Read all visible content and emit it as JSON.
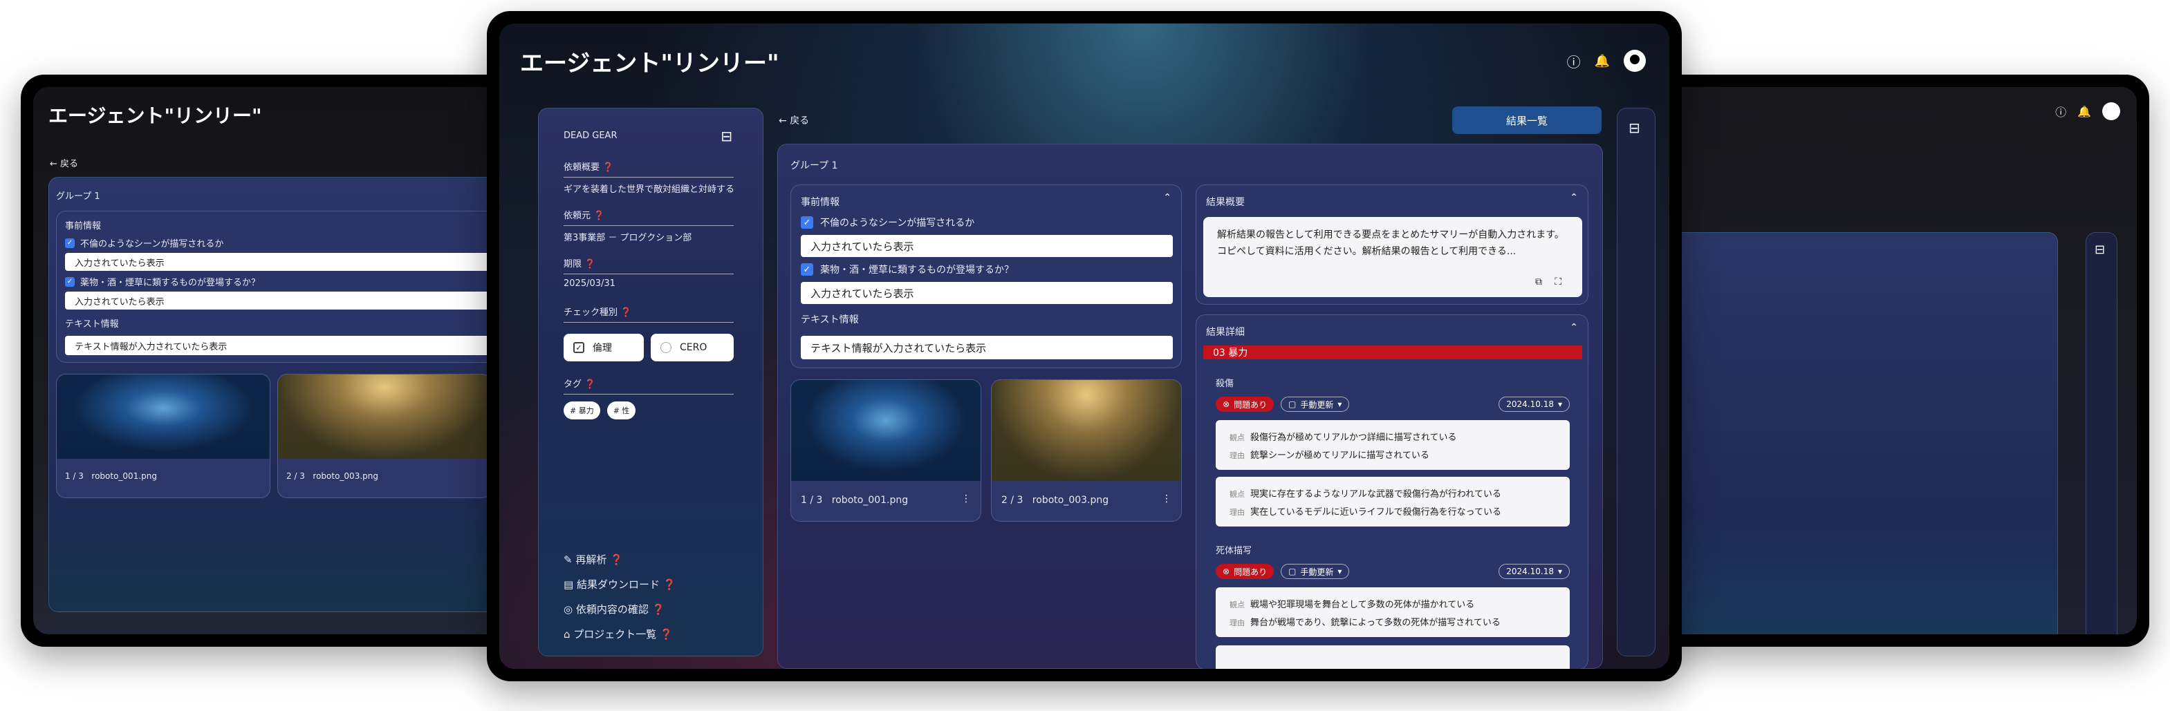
{
  "app": {
    "title": "エージェント\"リンリー\""
  },
  "nav": {
    "back_label": "戻る",
    "results_list_button": "結果一覧"
  },
  "sidebar": {
    "project": "DEAD GEAR",
    "fields": [
      {
        "label": "依頼概要",
        "value": "ギアを装着した世界で敵対組織と対峙する…"
      },
      {
        "label": "依頼元",
        "value": "第3事業部 － プログクション部"
      },
      {
        "label": "期限",
        "value": "2025/03/31"
      }
    ],
    "check_type_label": "チェック種別",
    "check_options": [
      {
        "label": "倫理",
        "checked": true
      },
      {
        "label": "CERO",
        "checked": false
      }
    ],
    "tags_label": "タグ",
    "tags": [
      "# 暴力",
      "# 性"
    ],
    "actions": [
      "再解析",
      "結果ダウンロード",
      "依頼内容の確認",
      "プロジェクト一覧"
    ]
  },
  "group": {
    "label": "グループ 1"
  },
  "pre_info": {
    "title": "事前情報",
    "items": [
      {
        "question": "不倫のようなシーンが描写されるか",
        "answer": "入力されていたら表示"
      },
      {
        "question": "薬物・酒・煙草に類するものが登場するか？",
        "answer": "入力されていたら表示"
      }
    ],
    "text_info_label": "テキスト情報",
    "text_info_value": "テキスト情報が入力されていたら表示"
  },
  "images": [
    {
      "counter": "1 / 3",
      "name": "roboto_001.png"
    },
    {
      "counter": "2 / 3",
      "name": "roboto_003.png"
    }
  ],
  "summary": {
    "title": "結果概要",
    "text": "解析結果の報告として利用できる要点をまとめたサマリーが自動入力されます。コピペして資料に活用ください。解析結果の報告として利用できる..."
  },
  "details": {
    "title": "結果詳細",
    "category": "03 暴力",
    "sections": [
      {
        "name": "殺傷",
        "status": "問題あり",
        "update": "手動更新",
        "date": "2024.10.18",
        "entries": [
          {
            "kanten": "殺傷行為が極めてリアルかつ詳細に描写されている",
            "riyu": "銃撃シーンが極めてリアルに描写されている"
          },
          {
            "kanten": "現実に存在するようなリアルな武器で殺傷行為が行われている",
            "riyu": "実在しているモデルに近いライフルで殺傷行為を行なっている"
          }
        ]
      },
      {
        "name": "死体描写",
        "status": "問題あり",
        "update": "手動更新",
        "date": "2024.10.18",
        "entries": [
          {
            "kanten": "戦場や犯罪現場を舞台として多数の死体が描かれている",
            "riyu": "舞台が戦場であり、銃撃によって多数の死体が描写されている"
          }
        ]
      }
    ],
    "kanten_label": "観点",
    "riyu_label": "理由"
  },
  "colors": {
    "accent": "#1f4f8f",
    "danger": "#c3121c",
    "checkbox": "#3c7bf0"
  },
  "icons": [
    "info-icon",
    "notification-icon",
    "account-icon",
    "collapse-sidebar-icon",
    "copy-icon",
    "expand-icon",
    "more-vert-icon",
    "chevron-up-icon",
    "arrow-left-icon"
  ]
}
